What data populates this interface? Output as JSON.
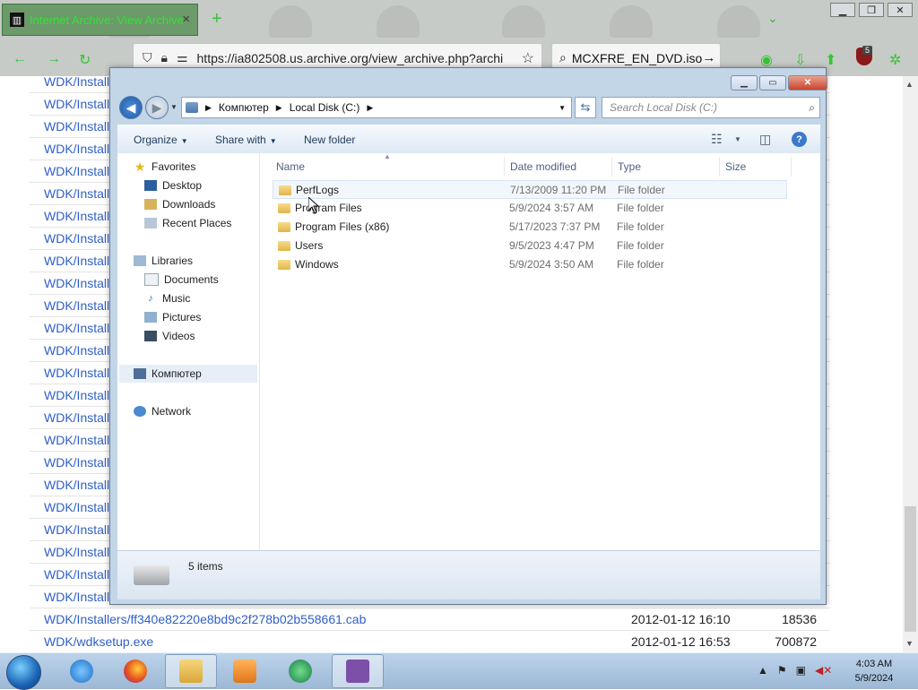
{
  "browser": {
    "tab_title": "Internet Archive: View Archive",
    "tab_close": "×",
    "new_tab": "+",
    "url": "https://ia802508.us.archive.org/view_archive.php?archi",
    "search_text": "MCXFRE_EN_DVD.iso",
    "extension_badge": "5"
  },
  "page": {
    "rows": [
      {
        "link": "WDK/Install",
        "date": "",
        "size": ""
      },
      {
        "link": "WDK/Install",
        "date": "",
        "size": ""
      },
      {
        "link": "WDK/Install",
        "date": "",
        "size": ""
      },
      {
        "link": "WDK/Install",
        "date": "",
        "size": ""
      },
      {
        "link": "WDK/Install",
        "date": "",
        "size": ""
      },
      {
        "link": "WDK/Install",
        "date": "",
        "size": ""
      },
      {
        "link": "WDK/Install",
        "date": "",
        "size": ""
      },
      {
        "link": "WDK/Install",
        "date": "",
        "size": ""
      },
      {
        "link": "WDK/Install",
        "date": "",
        "size": ""
      },
      {
        "link": "WDK/Install",
        "date": "",
        "size": ""
      },
      {
        "link": "WDK/Install",
        "date": "",
        "size": ""
      },
      {
        "link": "WDK/Install",
        "date": "",
        "size": ""
      },
      {
        "link": "WDK/Install",
        "date": "",
        "size": ""
      },
      {
        "link": "WDK/Install",
        "date": "",
        "size": ""
      },
      {
        "link": "WDK/Install",
        "date": "",
        "size": ""
      },
      {
        "link": "WDK/Install",
        "date": "",
        "size": ""
      },
      {
        "link": "WDK/Install",
        "date": "",
        "size": ""
      },
      {
        "link": "WDK/Install",
        "date": "",
        "size": ""
      },
      {
        "link": "WDK/Install",
        "date": "",
        "size": ""
      },
      {
        "link": "WDK/Install",
        "date": "",
        "size": ""
      },
      {
        "link": "WDK/Install",
        "date": "",
        "size": ""
      },
      {
        "link": "WDK/Install",
        "date": "",
        "size": ""
      },
      {
        "link": "WDK/Install",
        "date": "",
        "size": ""
      },
      {
        "link": "WDK/Install",
        "date": "",
        "size": ""
      },
      {
        "link": "WDK/Installers/ff340e82220e8bd9c2f278b02b558661.cab",
        "date": "2012-01-12 16:10",
        "size": "18536"
      },
      {
        "link": "WDK/wdksetup.exe",
        "date": "2012-01-12 16:53",
        "size": "700872"
      }
    ]
  },
  "explorer": {
    "breadcrumb": [
      "Компютер",
      "Local Disk (C:)"
    ],
    "search_placeholder": "Search Local Disk (C:)",
    "toolbar": {
      "organize": "Organize",
      "share_with": "Share with",
      "new_folder": "New folder"
    },
    "nav": {
      "favorites": "Favorites",
      "desktop": "Desktop",
      "downloads": "Downloads",
      "recent_places": "Recent Places",
      "libraries": "Libraries",
      "documents": "Documents",
      "music": "Music",
      "pictures": "Pictures",
      "videos": "Videos",
      "computer": "Компютер",
      "network": "Network"
    },
    "columns": {
      "name": "Name",
      "date_modified": "Date modified",
      "type": "Type",
      "size": "Size"
    },
    "files": [
      {
        "name": "PerfLogs",
        "date": "7/13/2009 11:20 PM",
        "type": "File folder"
      },
      {
        "name": "Program Files",
        "date": "5/9/2024 3:57 AM",
        "type": "File folder"
      },
      {
        "name": "Program Files (x86)",
        "date": "5/17/2023 7:37 PM",
        "type": "File folder"
      },
      {
        "name": "Users",
        "date": "9/5/2023 4:47 PM",
        "type": "File folder"
      },
      {
        "name": "Windows",
        "date": "5/9/2024 3:50 AM",
        "type": "File folder"
      }
    ],
    "status": "5 items"
  },
  "taskbar": {
    "time": "4:03 AM",
    "date": "5/9/2024"
  },
  "colors": {
    "link": "#2f5fc7",
    "tab_active_text": "#39e039",
    "taskbar": "#bcd3ea"
  }
}
